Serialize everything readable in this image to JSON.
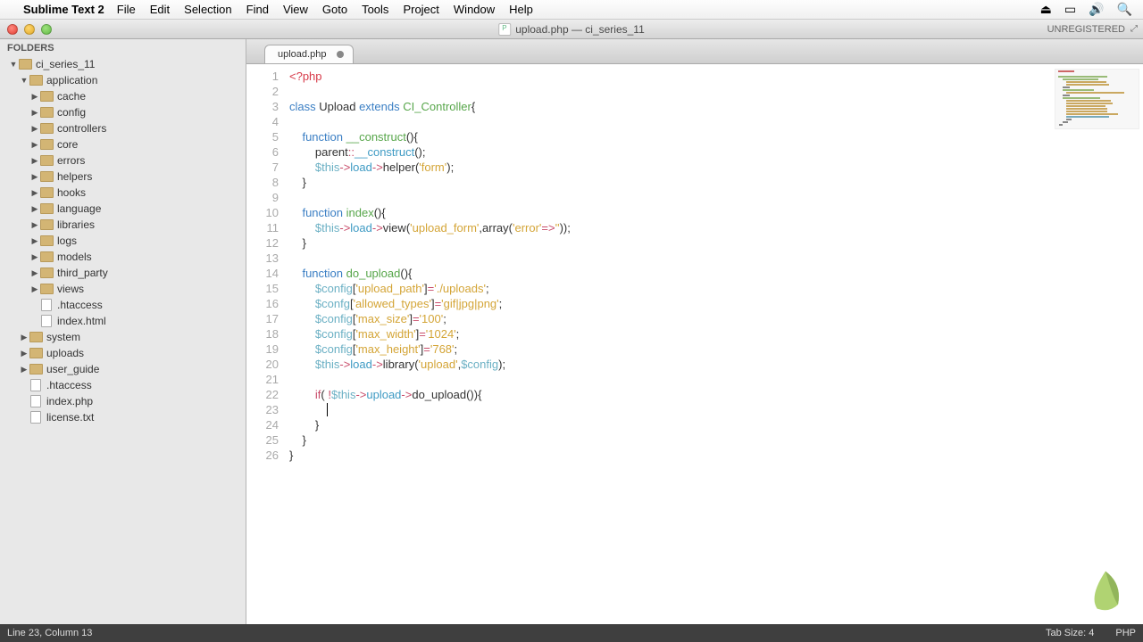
{
  "menubar": {
    "appname": "Sublime Text 2",
    "items": [
      "File",
      "Edit",
      "Selection",
      "Find",
      "View",
      "Goto",
      "Tools",
      "Project",
      "Window",
      "Help"
    ]
  },
  "window": {
    "title": "upload.php — ci_series_11",
    "unregistered": "UNREGISTERED"
  },
  "sidebar": {
    "heading": "FOLDERS",
    "tree": [
      {
        "depth": 0,
        "type": "folder",
        "open": true,
        "label": "ci_series_11"
      },
      {
        "depth": 1,
        "type": "folder",
        "open": true,
        "label": "application"
      },
      {
        "depth": 2,
        "type": "folder",
        "open": false,
        "label": "cache"
      },
      {
        "depth": 2,
        "type": "folder",
        "open": false,
        "label": "config"
      },
      {
        "depth": 2,
        "type": "folder",
        "open": false,
        "label": "controllers"
      },
      {
        "depth": 2,
        "type": "folder",
        "open": false,
        "label": "core"
      },
      {
        "depth": 2,
        "type": "folder",
        "open": false,
        "label": "errors"
      },
      {
        "depth": 2,
        "type": "folder",
        "open": false,
        "label": "helpers"
      },
      {
        "depth": 2,
        "type": "folder",
        "open": false,
        "label": "hooks"
      },
      {
        "depth": 2,
        "type": "folder",
        "open": false,
        "label": "language"
      },
      {
        "depth": 2,
        "type": "folder",
        "open": false,
        "label": "libraries"
      },
      {
        "depth": 2,
        "type": "folder",
        "open": false,
        "label": "logs"
      },
      {
        "depth": 2,
        "type": "folder",
        "open": false,
        "label": "models"
      },
      {
        "depth": 2,
        "type": "folder",
        "open": false,
        "label": "third_party"
      },
      {
        "depth": 2,
        "type": "folder",
        "open": false,
        "label": "views"
      },
      {
        "depth": 2,
        "type": "file",
        "label": ".htaccess"
      },
      {
        "depth": 2,
        "type": "file",
        "label": "index.html"
      },
      {
        "depth": 1,
        "type": "folder",
        "open": false,
        "label": "system"
      },
      {
        "depth": 1,
        "type": "folder",
        "open": false,
        "label": "uploads"
      },
      {
        "depth": 1,
        "type": "folder",
        "open": false,
        "label": "user_guide"
      },
      {
        "depth": 1,
        "type": "file",
        "label": ".htaccess"
      },
      {
        "depth": 1,
        "type": "file",
        "label": "index.php"
      },
      {
        "depth": 1,
        "type": "file",
        "label": "license.txt"
      }
    ]
  },
  "tabs": [
    {
      "label": "upload.php",
      "dirty": true
    }
  ],
  "editor": {
    "total_lines": 26,
    "cursor_line": 23,
    "cursor_col": 13,
    "lines": [
      {
        "n": 1,
        "tokens": [
          [
            "c-tag",
            "<?php"
          ]
        ]
      },
      {
        "n": 2,
        "tokens": []
      },
      {
        "n": 3,
        "tokens": [
          [
            "c-kw2",
            "class"
          ],
          [
            "",
            " "
          ],
          [
            "",
            "Upload"
          ],
          [
            "",
            " "
          ],
          [
            "c-kw2",
            "extends"
          ],
          [
            "",
            " "
          ],
          [
            "c-name",
            "CI_Controller"
          ],
          [
            "",
            "{"
          ]
        ]
      },
      {
        "n": 4,
        "tokens": []
      },
      {
        "n": 5,
        "tokens": [
          [
            "",
            "    "
          ],
          [
            "c-kw2",
            "function"
          ],
          [
            "",
            " "
          ],
          [
            "c-name",
            "__construct"
          ],
          [
            "",
            "(){"
          ]
        ]
      },
      {
        "n": 6,
        "tokens": [
          [
            "",
            "        "
          ],
          [
            "",
            "parent"
          ],
          [
            "c-kw",
            "::"
          ],
          [
            "c-fname",
            "__construct"
          ],
          [
            "",
            "();"
          ]
        ]
      },
      {
        "n": 7,
        "tokens": [
          [
            "",
            "        "
          ],
          [
            "c-var",
            "$this"
          ],
          [
            "c-kw",
            "->"
          ],
          [
            "c-fname",
            "load"
          ],
          [
            "c-kw",
            "->"
          ],
          [
            "",
            "helper"
          ],
          [
            "",
            "("
          ],
          [
            "c-str",
            "'form'"
          ],
          [
            "",
            ");"
          ]
        ]
      },
      {
        "n": 8,
        "tokens": [
          [
            "",
            "    }"
          ]
        ]
      },
      {
        "n": 9,
        "tokens": []
      },
      {
        "n": 10,
        "tokens": [
          [
            "",
            "    "
          ],
          [
            "c-kw2",
            "function"
          ],
          [
            "",
            " "
          ],
          [
            "c-name",
            "index"
          ],
          [
            "",
            "(){"
          ]
        ]
      },
      {
        "n": 11,
        "tokens": [
          [
            "",
            "        "
          ],
          [
            "c-var",
            "$this"
          ],
          [
            "c-kw",
            "->"
          ],
          [
            "c-fname",
            "load"
          ],
          [
            "c-kw",
            "->"
          ],
          [
            "",
            "view"
          ],
          [
            "",
            "("
          ],
          [
            "c-str",
            "'upload_form'"
          ],
          [
            "",
            ","
          ],
          [
            "",
            "array"
          ],
          [
            "",
            "("
          ],
          [
            "c-str",
            "'error'"
          ],
          [
            "c-kw",
            "=>"
          ],
          [
            "c-str",
            "''"
          ],
          [
            "",
            "));"
          ]
        ]
      },
      {
        "n": 12,
        "tokens": [
          [
            "",
            "    }"
          ]
        ]
      },
      {
        "n": 13,
        "tokens": []
      },
      {
        "n": 14,
        "tokens": [
          [
            "",
            "    "
          ],
          [
            "c-kw2",
            "function"
          ],
          [
            "",
            " "
          ],
          [
            "c-name",
            "do_upload"
          ],
          [
            "",
            "(){"
          ]
        ]
      },
      {
        "n": 15,
        "tokens": [
          [
            "",
            "        "
          ],
          [
            "c-var",
            "$config"
          ],
          [
            "",
            "["
          ],
          [
            "c-str",
            "'upload_path'"
          ],
          [
            "",
            "]"
          ],
          [
            "c-kw",
            "="
          ],
          [
            "c-str",
            "'./uploads'"
          ],
          [
            "",
            ";"
          ]
        ]
      },
      {
        "n": 16,
        "tokens": [
          [
            "",
            "        "
          ],
          [
            "c-var",
            "$confg"
          ],
          [
            "",
            "["
          ],
          [
            "c-str",
            "'allowed_types'"
          ],
          [
            "",
            "]"
          ],
          [
            "c-kw",
            "="
          ],
          [
            "c-str",
            "'gif|jpg|png'"
          ],
          [
            "",
            ";"
          ]
        ]
      },
      {
        "n": 17,
        "tokens": [
          [
            "",
            "        "
          ],
          [
            "c-var",
            "$config"
          ],
          [
            "",
            "["
          ],
          [
            "c-str",
            "'max_size'"
          ],
          [
            "",
            "]"
          ],
          [
            "c-kw",
            "="
          ],
          [
            "c-str",
            "'100'"
          ],
          [
            "",
            ";"
          ]
        ]
      },
      {
        "n": 18,
        "tokens": [
          [
            "",
            "        "
          ],
          [
            "c-var",
            "$config"
          ],
          [
            "",
            "["
          ],
          [
            "c-str",
            "'max_width'"
          ],
          [
            "",
            "]"
          ],
          [
            "c-kw",
            "="
          ],
          [
            "c-str",
            "'1024'"
          ],
          [
            "",
            ";"
          ]
        ]
      },
      {
        "n": 19,
        "tokens": [
          [
            "",
            "        "
          ],
          [
            "c-var",
            "$config"
          ],
          [
            "",
            "["
          ],
          [
            "c-str",
            "'max_height'"
          ],
          [
            "",
            "]"
          ],
          [
            "c-kw",
            "="
          ],
          [
            "c-str",
            "'768'"
          ],
          [
            "",
            ";"
          ]
        ]
      },
      {
        "n": 20,
        "tokens": [
          [
            "",
            "        "
          ],
          [
            "c-var",
            "$this"
          ],
          [
            "c-kw",
            "->"
          ],
          [
            "c-fname",
            "load"
          ],
          [
            "c-kw",
            "->"
          ],
          [
            "",
            "library"
          ],
          [
            "",
            "("
          ],
          [
            "c-str",
            "'upload'"
          ],
          [
            "",
            ","
          ],
          [
            "c-var",
            "$config"
          ],
          [
            "",
            ");"
          ]
        ]
      },
      {
        "n": 21,
        "tokens": []
      },
      {
        "n": 22,
        "tokens": [
          [
            "",
            "        "
          ],
          [
            "c-kw",
            "if"
          ],
          [
            "",
            "( "
          ],
          [
            "c-kw",
            "!"
          ],
          [
            "c-var",
            "$this"
          ],
          [
            "c-kw",
            "->"
          ],
          [
            "c-fname",
            "upload"
          ],
          [
            "c-kw",
            "->"
          ],
          [
            "",
            "do_upload"
          ],
          [
            "",
            "()){"
          ]
        ]
      },
      {
        "n": 23,
        "tokens": [
          [
            "",
            "            "
          ]
        ]
      },
      {
        "n": 24,
        "tokens": [
          [
            "",
            "        }"
          ]
        ]
      },
      {
        "n": 25,
        "tokens": [
          [
            "",
            "    }"
          ]
        ]
      },
      {
        "n": 26,
        "tokens": [
          [
            "",
            "}"
          ]
        ]
      }
    ]
  },
  "statusbar": {
    "position": "Line 23, Column 13",
    "tabsize": "Tab Size: 4",
    "syntax": "PHP"
  }
}
